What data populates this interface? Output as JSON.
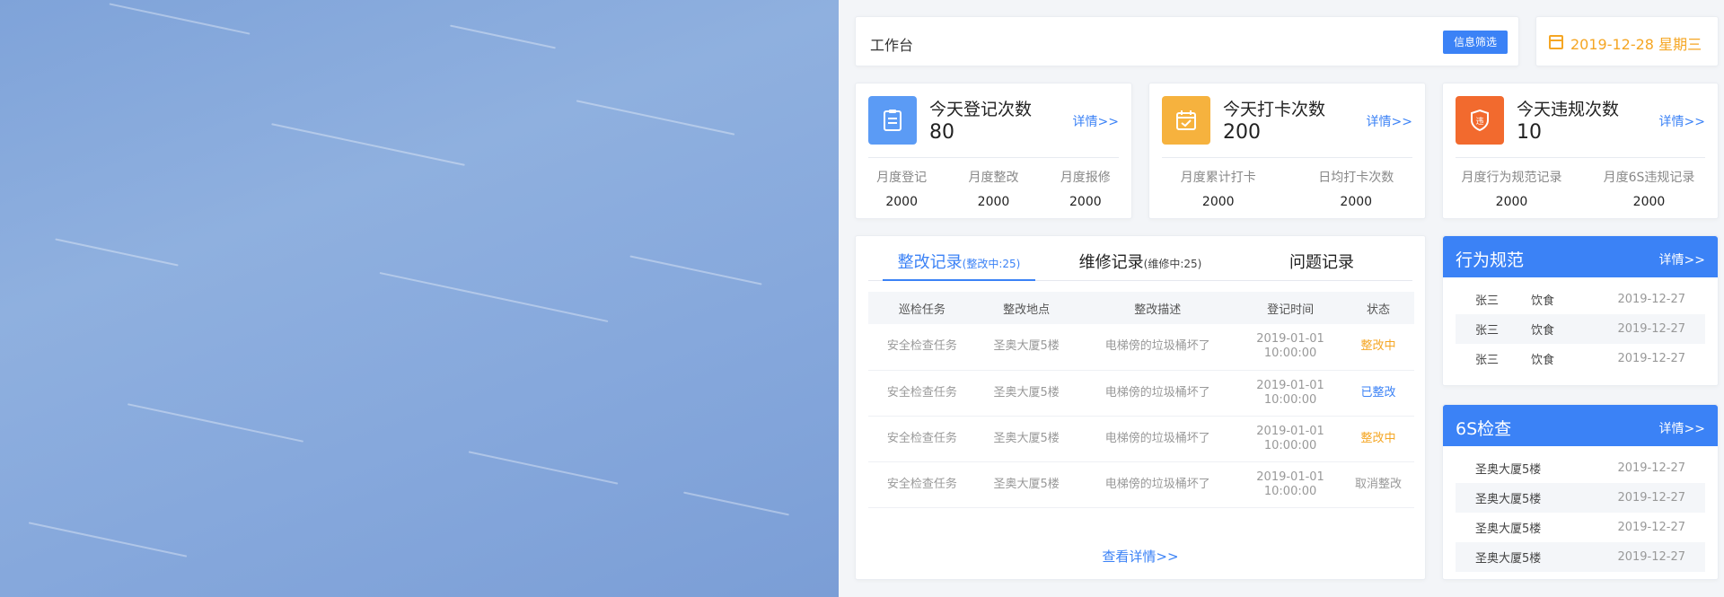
{
  "header": {
    "title": "工作台",
    "filter_button": "信息筛选",
    "date": "2019-12-28  星期三"
  },
  "stats": [
    {
      "title": "今天登记次数",
      "value": "80",
      "link": "详情>>",
      "icon": "clipboard-icon",
      "color": "#5b9bf5",
      "subs": [
        {
          "label": "月度登记",
          "value": "2000"
        },
        {
          "label": "月度整改",
          "value": "2000"
        },
        {
          "label": "月度报修",
          "value": "2000"
        }
      ]
    },
    {
      "title": "今天打卡次数",
      "value": "200",
      "link": "详情>>",
      "icon": "calendar-check-icon",
      "color": "#f6b23e",
      "subs": [
        {
          "label": "月度累计打卡",
          "value": "2000"
        },
        {
          "label": "日均打卡次数",
          "value": "2000"
        }
      ]
    },
    {
      "title": "今天违规次数",
      "value": "10",
      "link": "详情>>",
      "icon": "shield-icon",
      "color": "#f26a2e",
      "badge": "违",
      "subs": [
        {
          "label": "月度行为规范记录",
          "value": "2000"
        },
        {
          "label": "月度6S违规记录",
          "value": "2000"
        }
      ]
    }
  ],
  "records": {
    "tabs": [
      {
        "label": "整改记录",
        "sub": "(整改中:25)"
      },
      {
        "label": "维修记录",
        "sub": "(维修中:25)"
      },
      {
        "label": "问题记录",
        "sub": ""
      }
    ],
    "columns": [
      "巡检任务",
      "整改地点",
      "整改描述",
      "登记时间",
      "状态"
    ],
    "rows": [
      {
        "task": "安全检查任务",
        "place": "圣奥大厦5楼",
        "desc": "电梯傍的垃圾桶坏了",
        "date": "2019-01-01",
        "time": "10:00:00",
        "status": "整改中"
      },
      {
        "task": "安全检查任务",
        "place": "圣奥大厦5楼",
        "desc": "电梯傍的垃圾桶坏了",
        "date": "2019-01-01",
        "time": "10:00:00",
        "status": "已整改"
      },
      {
        "task": "安全检查任务",
        "place": "圣奥大厦5楼",
        "desc": "电梯傍的垃圾桶坏了",
        "date": "2019-01-01",
        "time": "10:00:00",
        "status": "整改中"
      },
      {
        "task": "安全检查任务",
        "place": "圣奥大厦5楼",
        "desc": "电梯傍的垃圾桶坏了",
        "date": "2019-01-01",
        "time": "10:00:00",
        "status": "取消整改"
      }
    ],
    "more": "查看详情>>"
  },
  "behavior": {
    "title": "行为规范",
    "link": "详情>>",
    "rows": [
      {
        "name": "张三",
        "type": "饮食",
        "date": "2019-12-27"
      },
      {
        "name": "张三",
        "type": "饮食",
        "date": "2019-12-27"
      },
      {
        "name": "张三",
        "type": "饮食",
        "date": "2019-12-27"
      }
    ]
  },
  "check6s": {
    "title": "6S检查",
    "link": "详情>>",
    "rows": [
      {
        "place": "圣奥大厦5楼",
        "date": "2019-12-27"
      },
      {
        "place": "圣奥大厦5楼",
        "date": "2019-12-27"
      },
      {
        "place": "圣奥大厦5楼",
        "date": "2019-12-27"
      },
      {
        "place": "圣奥大厦5楼",
        "date": "2019-12-27"
      }
    ]
  },
  "colors": {
    "accent": "#3b82f6",
    "warning": "#f5a623"
  }
}
